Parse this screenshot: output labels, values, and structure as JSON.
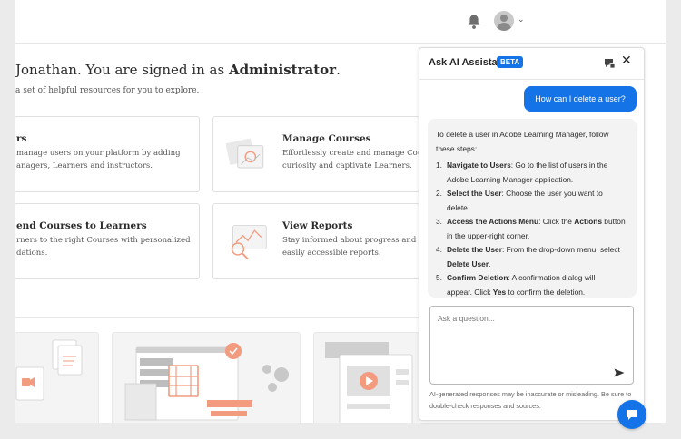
{
  "header": {
    "bell_icon": "bell-icon",
    "avatar_icon": "user-avatar-icon",
    "menu_icon": "chevron-down-icon",
    "chevron": "⌄"
  },
  "welcome": {
    "greeting_lead": " Jonathan. You are signed in as ",
    "role": "Administrator",
    "period": ".",
    "subtitle": " a set of helpful resources for you to explore."
  },
  "cards": [
    {
      "title": "rs",
      "desc_1": " manage users on your platform by adding",
      "desc_2": "anagers, Learners and instructors."
    },
    {
      "title": "Manage Courses",
      "desc_1": "Effortlessly create and manage Courses",
      "desc_2": "curiosity and captivate Learners."
    },
    {
      "title": "end Courses to Learners",
      "desc_1": "rners to the right Courses with personalized",
      "desc_2": "dations."
    },
    {
      "title": "View Reports",
      "desc_1": "Stay informed about progress and perfo",
      "desc_2": "easily accessible reports."
    }
  ],
  "assistant": {
    "title": "Ask AI Assistant",
    "badge": "BETA",
    "close": "✕",
    "chat_icon": "chat-history-icon",
    "user_question": "How can I delete a user?",
    "intro_1": "To delete a user in Adobe Learning Manager, follow",
    "intro_2": "these steps:",
    "steps": [
      {
        "num": "1.",
        "title": "Navigate to Users",
        "line1_rest": ": Go to the list of users in the",
        "line2": "Adobe Learning Manager application."
      },
      {
        "num": "2.",
        "title": "Select the User",
        "line1_rest": ": Choose the user you want to",
        "line2": "delete."
      },
      {
        "num": "3.",
        "title": "Access the Actions Menu",
        "line1_rest": ": Click the ",
        "bold2": "Actions",
        "line1_tail": " button",
        "line2": "in the upper-right corner."
      },
      {
        "num": "4.",
        "title": "Delete the User",
        "line1_rest": ": From the drop-down menu, select",
        "line2_bold": "Delete User",
        "line2_tail": "."
      },
      {
        "num": "5.",
        "title": "Confirm Deletion",
        "line1_rest": ": A confirmation dialog will",
        "line2_pre": "appear. Click ",
        "line2_bold": "Yes",
        "line2_tail": " to confirm the deletion."
      }
    ],
    "input_placeholder": "Ask a question...",
    "send_icon": "send-icon",
    "disclaimer_1": "AI-generated responses may be inaccurate or misleading. Be sure to",
    "disclaimer_2": "double-check responses and sources.",
    "fab_icon": "chat-bubble-icon"
  },
  "colors": {
    "accent": "#1473e6",
    "illustration_orange": "#f29b7e"
  }
}
